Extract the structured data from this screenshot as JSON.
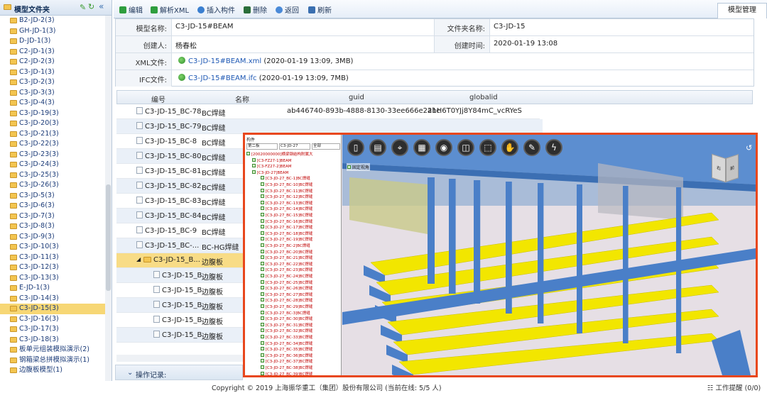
{
  "sidebar": {
    "title": "模型文件夹",
    "items": [
      {
        "label": "B2-JD-2(3)"
      },
      {
        "label": "GH-JD-1(3)"
      },
      {
        "label": "D-JD-1(3)"
      },
      {
        "label": "C2-JD-1(3)"
      },
      {
        "label": "C2-JD-2(3)"
      },
      {
        "label": "C3-JD-1(3)"
      },
      {
        "label": "C3-JD-2(3)"
      },
      {
        "label": "C3-JD-3(3)"
      },
      {
        "label": "C3-JD-4(3)"
      },
      {
        "label": "C3-JD-19(3)"
      },
      {
        "label": "C3-JD-20(3)"
      },
      {
        "label": "C3-JD-21(3)"
      },
      {
        "label": "C3-JD-22(3)"
      },
      {
        "label": "C3-JD-23(3)"
      },
      {
        "label": "C3-JD-24(3)"
      },
      {
        "label": "C3-JD-25(3)"
      },
      {
        "label": "C3-JD-26(3)"
      },
      {
        "label": "C3-JD-5(3)"
      },
      {
        "label": "C3-JD-6(3)"
      },
      {
        "label": "C3-JD-7(3)"
      },
      {
        "label": "C3-JD-8(3)"
      },
      {
        "label": "C3-JD-9(3)"
      },
      {
        "label": "C3-JD-10(3)"
      },
      {
        "label": "C3-JD-11(3)"
      },
      {
        "label": "C3-JD-12(3)"
      },
      {
        "label": "C3-JD-13(3)"
      },
      {
        "label": "E-JD-1(3)"
      },
      {
        "label": "C3-JD-14(3)"
      },
      {
        "label": "C3-JD-15(3)",
        "selected": true
      },
      {
        "label": "C3-JD-16(3)"
      },
      {
        "label": "C3-JD-17(3)"
      },
      {
        "label": "C3-JD-18(3)"
      },
      {
        "label": "板单元组装模拟演示(2)"
      },
      {
        "label": "钢箱梁总拼模拟演示(1)"
      },
      {
        "label": "边腹板模型(1)"
      }
    ]
  },
  "toolbar": {
    "edit": "编辑",
    "parse_xml": "解析XML",
    "insert": "插入构件",
    "delete": "删除",
    "back": "返回",
    "refresh": "刷新",
    "tab": "模型管理"
  },
  "info": {
    "model_name_label": "模型名称:",
    "model_name": "C3-JD-15#BEAM",
    "folder_label": "文件夹名称:",
    "folder": "C3-JD-15",
    "creator_label": "创建人:",
    "creator": "杨春松",
    "created_label": "创建时间:",
    "created": "2020-01-19 13:08",
    "xml_label": "XML文件:",
    "xml_file": "C3-JD-15#BEAM.xml",
    "xml_meta": "(2020-01-19 13:09, 3MB)",
    "ifc_label": "IFC文件:",
    "ifc_file": "C3-JD-15#BEAM.ifc",
    "ifc_meta": "(2020-01-19 13:09, 7MB)"
  },
  "table": {
    "headers": [
      "编号",
      "名称",
      "guid",
      "globalid"
    ],
    "rows": [
      {
        "id": "C3-JD-15_BC-78",
        "name": "BC焊缝",
        "guid": "ab446740-893b-4888-8130-33ee666e2a1c",
        "globalid": "2hH6T0YJj8Y84mC_vcRYeS"
      },
      {
        "id": "C3-JD-15_BC-79",
        "name": "BC焊缝",
        "guid": "",
        "globalid": ""
      },
      {
        "id": "C3-JD-15_BC-8",
        "name": "BC焊缝",
        "guid": "",
        "globalid": ""
      },
      {
        "id": "C3-JD-15_BC-80",
        "name": "BC焊缝",
        "guid": "",
        "globalid": ""
      },
      {
        "id": "C3-JD-15_BC-81",
        "name": "BC焊缝",
        "guid": "",
        "globalid": ""
      },
      {
        "id": "C3-JD-15_BC-82",
        "name": "BC焊缝",
        "guid": "",
        "globalid": ""
      },
      {
        "id": "C3-JD-15_BC-83",
        "name": "BC焊缝",
        "guid": "",
        "globalid": ""
      },
      {
        "id": "C3-JD-15_BC-84",
        "name": "BC焊缝",
        "guid": "",
        "globalid": ""
      },
      {
        "id": "C3-JD-15_BC-9",
        "name": "BC焊缝",
        "guid": "",
        "globalid": ""
      },
      {
        "id": "C3-JD-15_BC-...",
        "name": "BC-HG焊缝",
        "guid": "",
        "globalid": ""
      },
      {
        "id": "C3-JD-15_B...",
        "name": "边腹板",
        "guid": "",
        "globalid": ""
      },
      {
        "id": "C3-JD-15_B...",
        "name": "边腹板",
        "guid": "",
        "globalid": ""
      },
      {
        "id": "C3-JD-15_B...",
        "name": "边腹板",
        "guid": "",
        "globalid": ""
      },
      {
        "id": "C3-JD-15_B...",
        "name": "边腹板",
        "guid": "",
        "globalid": ""
      },
      {
        "id": "C3-JD-15_B...",
        "name": "边腹板",
        "guid": "",
        "globalid": ""
      },
      {
        "id": "C3-JD-15_B...",
        "name": "边腹板",
        "guid": "",
        "globalid": ""
      }
    ]
  },
  "oplog": "操作记录:",
  "footer": {
    "copyright": "Copyright © 2019 上海振华重工（集团）股份有限公司  (当前在线: 5/5 人)",
    "reminder": "工作提醒 (0/0)"
  },
  "viewer": {
    "tree_header": "构件",
    "filter1": "C3-JD-27",
    "filter2": "全部",
    "layer": "第二板",
    "fixed_label": "固定视角",
    "tree_rows": [
      {
        "label": "[20020000000]横梁钢结构附属大",
        "color": "#c00000"
      },
      {
        "label": "[C3-FZ27-1]BEAM",
        "color": "#c00000"
      },
      {
        "label": "[C3-FZ27-2]BEAM",
        "color": "#c00000"
      },
      {
        "label": "[C3-JD-27]BEAM",
        "color": "#c00000"
      },
      {
        "label": "[C3-JD-27_BC-1]BC焊缝",
        "color": "#c00000"
      },
      {
        "label": "[C3-JD-27_BC-10]BC焊缝",
        "color": "#c00000"
      },
      {
        "label": "[C3-JD-27_BC-11]BC焊缝",
        "color": "#c00000"
      },
      {
        "label": "[C3-JD-27_BC-12]BC焊缝",
        "color": "#c00000"
      },
      {
        "label": "[C3-JD-27_BC-13]BC焊缝",
        "color": "#c00000"
      },
      {
        "label": "[C3-JD-27_BC-14]BC焊缝",
        "color": "#c00000"
      },
      {
        "label": "[C3-JD-27_BC-15]BC焊缝",
        "color": "#c00000"
      },
      {
        "label": "[C3-JD-27_BC-16]BC焊缝",
        "color": "#c00000"
      },
      {
        "label": "[C3-JD-27_BC-17]BC焊缝",
        "color": "#c00000"
      },
      {
        "label": "[C3-JD-27_BC-18]BC焊缝",
        "color": "#c00000"
      },
      {
        "label": "[C3-JD-27_BC-19]BC焊缝",
        "color": "#c00000"
      },
      {
        "label": "[C3-JD-27_BC-2]BC焊缝",
        "color": "#c00000"
      },
      {
        "label": "[C3-JD-27_BC-20]BC焊缝",
        "color": "#c00000"
      },
      {
        "label": "[C3-JD-27_BC-21]BC焊缝",
        "color": "#c00000"
      },
      {
        "label": "[C3-JD-27_BC-22]BC焊缝",
        "color": "#c00000"
      },
      {
        "label": "[C3-JD-27_BC-23]BC焊缝",
        "color": "#c00000"
      },
      {
        "label": "[C3-JD-27_BC-24]BC焊缝",
        "color": "#c00000"
      },
      {
        "label": "[C3-JD-27_BC-25]BC焊缝",
        "color": "#c00000"
      },
      {
        "label": "[C3-JD-27_BC-26]BC焊缝",
        "color": "#c00000"
      },
      {
        "label": "[C3-JD-27_BC-27]BC焊缝",
        "color": "#c00000"
      },
      {
        "label": "[C3-JD-27_BC-28]BC焊缝",
        "color": "#c00000"
      },
      {
        "label": "[C3-JD-27_BC-29]BC焊缝",
        "color": "#c00000"
      },
      {
        "label": "[C3-JD-27_BC-3]BC焊缝",
        "color": "#c00000"
      },
      {
        "label": "[C3-JD-27_BC-30]BC焊缝",
        "color": "#c00000"
      },
      {
        "label": "[C3-JD-27_BC-31]BC焊缝",
        "color": "#c00000"
      },
      {
        "label": "[C3-JD-27_BC-32]BC焊缝",
        "color": "#c00000"
      },
      {
        "label": "[C3-JD-27_BC-33]BC焊缝",
        "color": "#c00000"
      },
      {
        "label": "[C3-JD-27_BC-34]BC焊缝",
        "color": "#c00000"
      },
      {
        "label": "[C3-JD-27_BC-35]BC焊缝",
        "color": "#c00000"
      },
      {
        "label": "[C3-JD-27_BC-36]BC焊缝",
        "color": "#c00000"
      },
      {
        "label": "[C3-JD-27_BC-37]BC焊缝",
        "color": "#c00000"
      },
      {
        "label": "[C3-JD-27_BC-38]BC焊缝",
        "color": "#c00000"
      },
      {
        "label": "[C3-JD-27_BC-39]BC焊缝",
        "color": "#c00000"
      }
    ],
    "tools": [
      "new-icon",
      "map-icon",
      "pin-icon",
      "grid-icon",
      "camera-icon",
      "split-icon",
      "frame-icon",
      "hand-icon",
      "pen-icon",
      "stumble-icon"
    ],
    "cube_left": "右",
    "cube_right": "前",
    "colors": {
      "beam": "#4a7fc8",
      "flange": "#f2e600",
      "frame": "#e8471d"
    }
  }
}
